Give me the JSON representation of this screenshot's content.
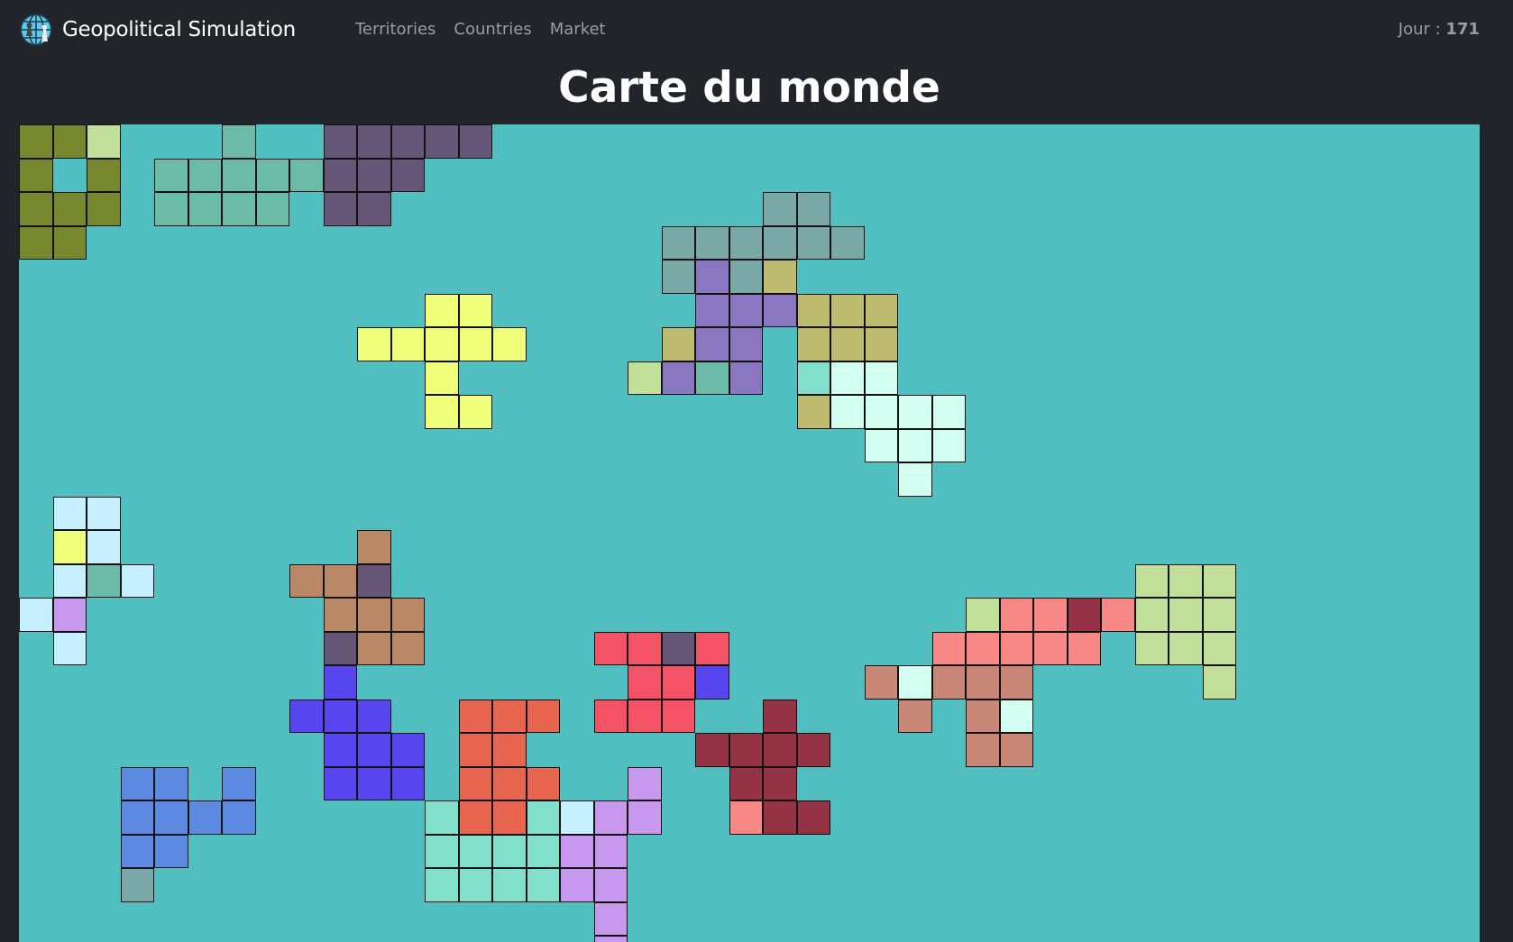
{
  "navbar": {
    "brand": "Geopolitical Simulation",
    "links": [
      "Territories",
      "Countries",
      "Market"
    ],
    "day_label": "Jour :",
    "day_value": "171"
  },
  "page_title": "Carte du monde",
  "map": {
    "water_color": "#51bec0",
    "palette": {
      "O": "#77872d",
      "G": "#c2df9a",
      "T": "#6cbba8",
      "P": "#665678",
      "S": "#7aa8a6",
      "V": "#8a77c2",
      "K": "#bcbb70",
      "Y": "#f0ff7a",
      "M": "#d2fff0",
      "A": "#82dfcb",
      "B": "#c6efff",
      "L": "#c898ee",
      "N": "#b98866",
      "I": "#5746f0",
      "R": "#e86650",
      "E": "#f45266",
      "X": "#943346",
      "F": "#f78886",
      "W": "#c98877",
      "C": "#5b8ae0"
    },
    "rows": [
      "OOG...T..PPPPP",
      "O.O.TTTTTPPP",
      "OOO.TTTT.PP...........SS",
      "OO.................SSSSSS",
      "...................SVSK",
      "............YY......VVVKKK",
      "..........YYYYY....KVV.KKK",
      "............Y.....GVTV.AMM",
      "............YY.........KMMMM",
      ".........................MMM",
      "..........................M",
      ".BB",
      ".YB.......N",
      ".BTB....NNP......................GGG",
      "BL.......NNN................GFFXFGGG",
      ".B.......PNN.....EEPE......FFFFF.GGG",
      ".........I........EEI....WMWWW.....G",
      "........III..RRR.EEE..X...W.WM",
      ".........III.RR.....XXXX....WW",
      "...CC.C..III.RRR..L..XX",
      "...CCCC.....ARRABLL..FXX",
      "...CC.......AAAALL",
      "...S........AAAALL",
      ".................L",
      ".................L"
    ]
  }
}
